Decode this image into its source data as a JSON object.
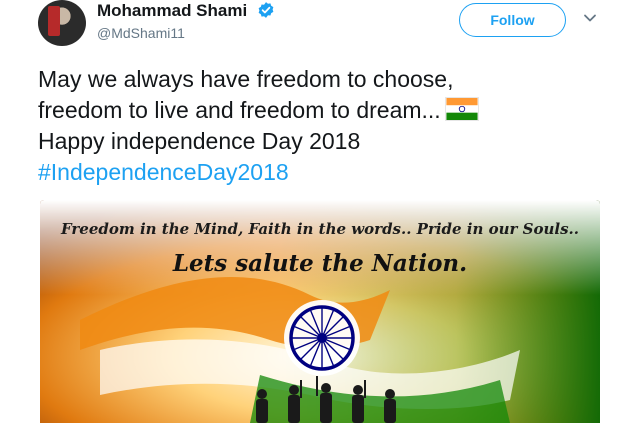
{
  "user": {
    "name": "Mohammad Shami",
    "handle": "@MdShami11",
    "verified": true
  },
  "actions": {
    "follow_label": "Follow"
  },
  "tweet": {
    "lines": [
      "May we always have freedom to choose,",
      "freedom to live and freedom to dream...",
      "Happy independence Day 2018"
    ],
    "hashtag": "#IndependenceDay2018",
    "emoji": "indian-flag"
  },
  "media": {
    "caption_top": "Freedom in the Mind, Faith in the words.. Pride in our Souls..",
    "caption_main": "Lets salute the Nation."
  },
  "colors": {
    "accent": "#1da1f2",
    "saffron": "#ff9933",
    "green": "#138808",
    "chakra": "#000080"
  }
}
